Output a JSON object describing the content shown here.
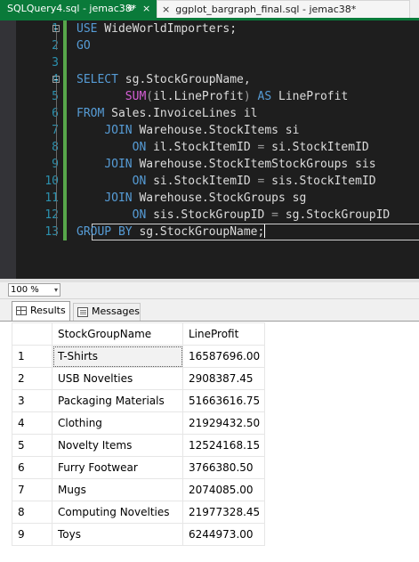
{
  "tabs": {
    "active": {
      "title": "SQLQuery4.sql - jemac38*",
      "pin_glyph": "⊕",
      "close_glyph": "×"
    },
    "other": {
      "title": "ggplot_bargraph_final.sql - jemac38*",
      "close_glyph": "×"
    }
  },
  "colors": {
    "tab_accent": "#0a7a3a",
    "editor_bg": "#1e1e1e",
    "line_number": "#2b91af",
    "keyword": "#569cd6",
    "function": "#d75fd7",
    "change_bar": "#57a64a"
  },
  "editor": {
    "lines": [
      {
        "n": "1",
        "segs": [
          {
            "c": "kw",
            "t": "USE"
          },
          {
            "c": "tx",
            "t": " WideWorldImporters;"
          }
        ]
      },
      {
        "n": "2",
        "segs": [
          {
            "c": "kw",
            "t": "GO"
          }
        ]
      },
      {
        "n": "3",
        "segs": []
      },
      {
        "n": "4",
        "segs": [
          {
            "c": "kw",
            "t": "SELECT"
          },
          {
            "c": "tx",
            "t": " sg.StockGroupName,"
          }
        ]
      },
      {
        "n": "5",
        "segs": [
          {
            "c": "tx",
            "t": "       "
          },
          {
            "c": "fn",
            "t": "SUM"
          },
          {
            "c": "gr",
            "t": "("
          },
          {
            "c": "tx",
            "t": "il.LineProfit"
          },
          {
            "c": "gr",
            "t": ")"
          },
          {
            "c": "tx",
            "t": " "
          },
          {
            "c": "kw",
            "t": "AS"
          },
          {
            "c": "tx",
            "t": " LineProfit"
          }
        ]
      },
      {
        "n": "6",
        "segs": [
          {
            "c": "kw",
            "t": "FROM"
          },
          {
            "c": "tx",
            "t": " Sales.InvoiceLines il"
          }
        ]
      },
      {
        "n": "7",
        "segs": [
          {
            "c": "tx",
            "t": "    "
          },
          {
            "c": "kw",
            "t": "JOIN"
          },
          {
            "c": "tx",
            "t": " Warehouse.StockItems si"
          }
        ]
      },
      {
        "n": "8",
        "segs": [
          {
            "c": "tx",
            "t": "        "
          },
          {
            "c": "kw",
            "t": "ON"
          },
          {
            "c": "tx",
            "t": " il.StockItemID "
          },
          {
            "c": "gr",
            "t": "="
          },
          {
            "c": "tx",
            "t": " si.StockItemID"
          }
        ]
      },
      {
        "n": "9",
        "segs": [
          {
            "c": "tx",
            "t": "    "
          },
          {
            "c": "kw",
            "t": "JOIN"
          },
          {
            "c": "tx",
            "t": " Warehouse.StockItemStockGroups sis"
          }
        ]
      },
      {
        "n": "10",
        "segs": [
          {
            "c": "tx",
            "t": "        "
          },
          {
            "c": "kw",
            "t": "ON"
          },
          {
            "c": "tx",
            "t": " si.StockItemID "
          },
          {
            "c": "gr",
            "t": "="
          },
          {
            "c": "tx",
            "t": " sis.StockItemID"
          }
        ]
      },
      {
        "n": "11",
        "segs": [
          {
            "c": "tx",
            "t": "    "
          },
          {
            "c": "kw",
            "t": "JOIN"
          },
          {
            "c": "tx",
            "t": " Warehouse.StockGroups sg"
          }
        ]
      },
      {
        "n": "12",
        "segs": [
          {
            "c": "tx",
            "t": "        "
          },
          {
            "c": "kw",
            "t": "ON"
          },
          {
            "c": "tx",
            "t": " sis.StockGroupID "
          },
          {
            "c": "gr",
            "t": "="
          },
          {
            "c": "tx",
            "t": " sg.StockGroupID"
          }
        ]
      },
      {
        "n": "13",
        "segs": [
          {
            "c": "kw",
            "t": "GROUP BY"
          },
          {
            "c": "tx",
            "t": " sg.StockGroupName;"
          }
        ]
      }
    ],
    "current_line": "13"
  },
  "zoom": {
    "value": "100 %",
    "arrow": "▾"
  },
  "results_tabs": [
    {
      "label": "Results",
      "icon": "grid-icon",
      "active": true
    },
    {
      "label": "Messages",
      "icon": "messages-icon",
      "active": false
    }
  ],
  "results": {
    "columns": [
      "StockGroupName",
      "LineProfit"
    ],
    "rows": [
      {
        "n": "1",
        "name": "T-Shirts",
        "profit": "16587696.00"
      },
      {
        "n": "2",
        "name": "USB Novelties",
        "profit": "2908387.45"
      },
      {
        "n": "3",
        "name": "Packaging Materials",
        "profit": "51663616.75"
      },
      {
        "n": "4",
        "name": "Clothing",
        "profit": "21929432.50"
      },
      {
        "n": "5",
        "name": "Novelty Items",
        "profit": "12524168.15"
      },
      {
        "n": "6",
        "name": "Furry Footwear",
        "profit": "3766380.50"
      },
      {
        "n": "7",
        "name": "Mugs",
        "profit": "2074085.00"
      },
      {
        "n": "8",
        "name": "Computing Novelties",
        "profit": "21977328.45"
      },
      {
        "n": "9",
        "name": "Toys",
        "profit": "6244973.00"
      }
    ],
    "selected_row": "1"
  }
}
